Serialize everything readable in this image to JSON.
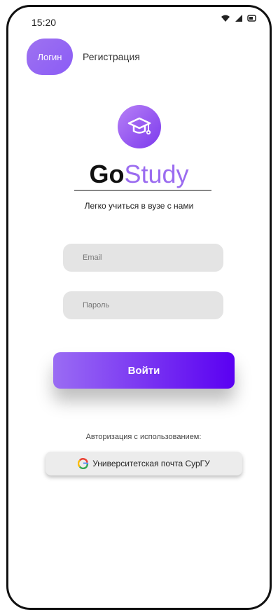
{
  "status_bar": {
    "time": "15:20",
    "icons": [
      "wifi-icon",
      "signal-icon",
      "battery-icon"
    ]
  },
  "tabs": {
    "login": "Логин",
    "register": "Регистрация"
  },
  "logo": {
    "icon": "graduation-cap-icon",
    "brand_part1": "Go",
    "brand_part2": "Study"
  },
  "tagline": "Легко учиться в вузе с нами",
  "form": {
    "email_placeholder": "Email",
    "password_placeholder": "Пароль",
    "submit_label": "Войти"
  },
  "auth": {
    "label": "Авторизация с использованием:",
    "google_button": "Университетская почта СурГУ",
    "google_icon": "google-icon"
  },
  "colors": {
    "accent": "#9b6cf0",
    "button_end": "#5a00f2"
  }
}
